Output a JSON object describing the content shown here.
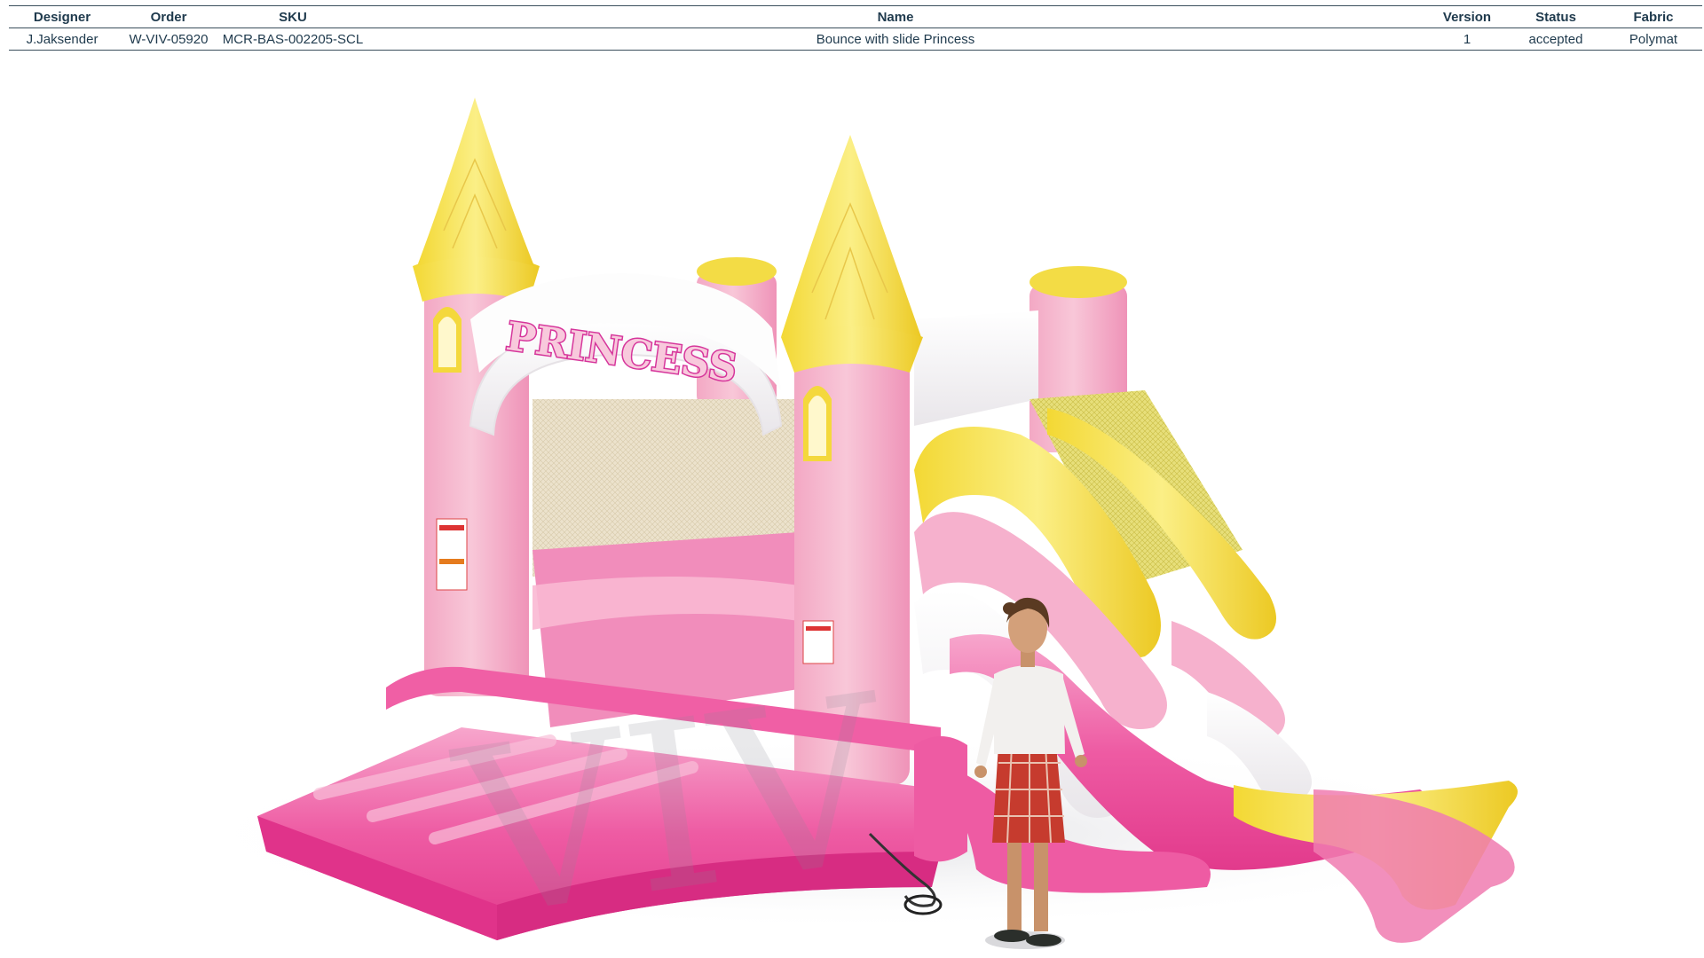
{
  "spec_table": {
    "headers": {
      "designer": "Designer",
      "order": "Order",
      "sku": "SKU",
      "name": "Name",
      "version": "Version",
      "status": "Status",
      "fabric": "Fabric"
    },
    "row": {
      "designer": "J.Jaksender",
      "order": "W-VIV-05920",
      "sku": "MCR-BAS-002205-SCL",
      "name": "Bounce with slide Princess",
      "version": "1",
      "status": "accepted",
      "fabric": "Polymat"
    }
  },
  "product_render": {
    "banner_text": "PRINCESS",
    "watermark_text": "VIV",
    "colors": {
      "pink_light": "#f6b9cf",
      "pink_mid": "#f48ab6",
      "pink_hot": "#ec3d93",
      "yellow": "#f7e24a",
      "yellow_dark": "#e8c21c",
      "white": "#fbfbfb",
      "net": "#e8dcc4"
    }
  }
}
